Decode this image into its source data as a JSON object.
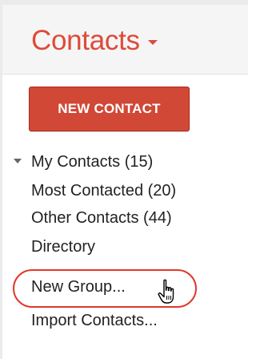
{
  "header": {
    "title": "Contacts"
  },
  "toolbar": {
    "new_contact_label": "NEW CONTACT"
  },
  "nav": {
    "items": [
      {
        "label": "My Contacts (15)"
      },
      {
        "label": "Most Contacted (20)"
      },
      {
        "label": "Other Contacts (44)"
      },
      {
        "label": "Directory"
      },
      {
        "label": "New Group..."
      },
      {
        "label": "Import Contacts..."
      }
    ]
  },
  "colors": {
    "brand_red": "#dd4b39",
    "button_red": "#d14836",
    "highlight_ring": "#e0392b"
  },
  "icons": {
    "expand": "caret-down-icon",
    "title_menu": "caret-down-icon",
    "pointer": "hand-cursor-icon"
  }
}
